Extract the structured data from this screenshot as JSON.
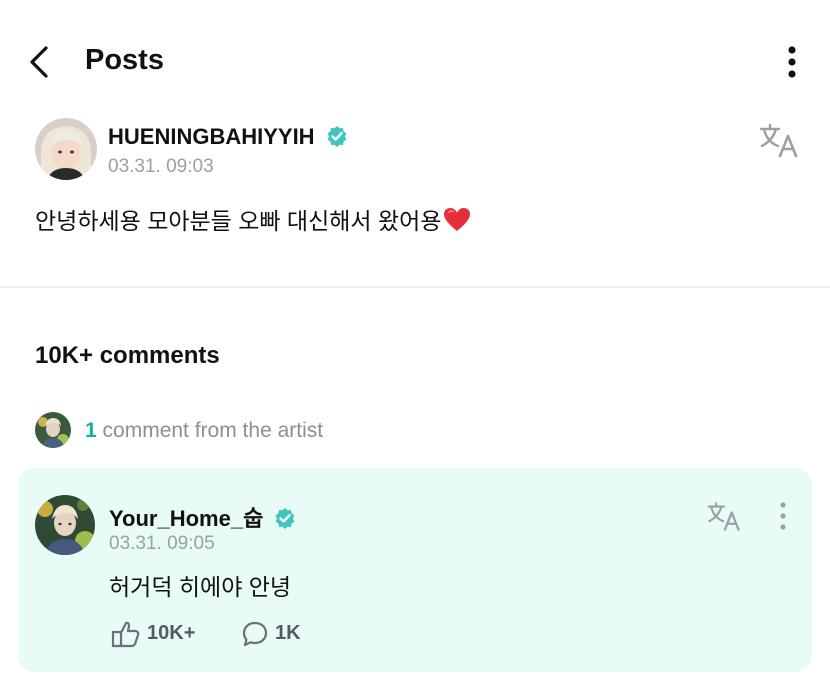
{
  "header": {
    "title": "Posts"
  },
  "post": {
    "author": "HUENINGBAHIYYIH",
    "time": "03.31. 09:03",
    "text": "안녕하세용 모아분들 오빠 대신해서 왔어용"
  },
  "comments": {
    "count_label": "10K+ comments",
    "artist_count": "1",
    "artist_label": "comment from the artist"
  },
  "comment": {
    "author": "Your_Home_숩",
    "time": "03.31. 09:05",
    "text": "허거덕 히에야 안녕",
    "likes": "10K+",
    "replies": "1K"
  },
  "colors": {
    "accent": "#0bb3a1",
    "card_bg": "#e9fbf7",
    "verified": "#3fc6c0"
  },
  "icons": [
    "back-arrow-icon",
    "more-vertical-icon",
    "translate-icon",
    "verified-badge-icon",
    "heart-icon",
    "like-icon",
    "reply-icon"
  ]
}
